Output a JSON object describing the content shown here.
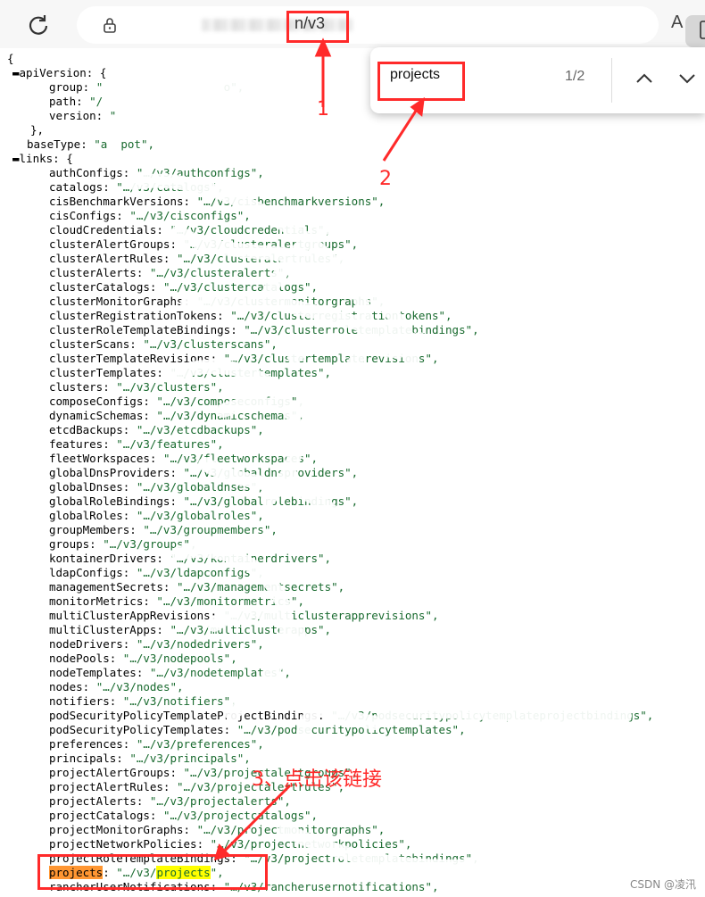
{
  "browser": {
    "url_suffix": "n/v3",
    "find_query": "projects",
    "find_count": "1/2",
    "read_aloud": "A"
  },
  "json_lines": [
    {
      "indent": "{",
      "key": "",
      "value": ""
    },
    {
      "indent": "▬",
      "key": "apiVersion: ",
      "value": "{"
    },
    {
      "indent": "    ",
      "key": "group: ",
      "value": "\"",
      "tail": "o\","
    },
    {
      "indent": "    ",
      "key": "path: ",
      "value": "\"/",
      "tail": ""
    },
    {
      "indent": "    ",
      "key": "version: ",
      "value": "\"",
      "tail": ""
    },
    {
      "indent": "  ",
      "key": "},",
      "value": ""
    },
    {
      "indent": "  ",
      "key": "baseType: ",
      "value": "\"a",
      "tail": "pot\","
    },
    {
      "indent": "▬",
      "key": "links: ",
      "value": "{"
    }
  ],
  "links": [
    {
      "key": "authConfigs",
      "value": "\"…/v3/authconfigs\","
    },
    {
      "key": "catalogs",
      "value": "\"…/v3/catalogs\","
    },
    {
      "key": "cisBenchmarkVersions",
      "value": "\"…/v3/cisbenchmarkversions\","
    },
    {
      "key": "cisConfigs",
      "value": "\"…/v3/cisconfigs\","
    },
    {
      "key": "cloudCredentials",
      "value": "\"…/v3/cloudcredentials\","
    },
    {
      "key": "clusterAlertGroups",
      "value": "\"…/v3/clusteralertgroups\","
    },
    {
      "key": "clusterAlertRules",
      "value": "\"…/v3/clusteralertrules\","
    },
    {
      "key": "clusterAlerts",
      "value": "\"…/v3/clusteralerts\","
    },
    {
      "key": "clusterCatalogs",
      "value": "\"…/v3/clustercatalogs\","
    },
    {
      "key": "clusterMonitorGraphs",
      "value": "\"…/v3/clustermonitorgraphs\","
    },
    {
      "key": "clusterRegistrationTokens",
      "value": "\"…/v3/clusterregistrationtokens\","
    },
    {
      "key": "clusterRoleTemplateBindings",
      "value": "\"…/v3/clusterroletemplatebindings\","
    },
    {
      "key": "clusterScans",
      "value": "\"…/v3/clusterscans\","
    },
    {
      "key": "clusterTemplateRevisions",
      "value": "\"…/v3/clustertemplaterevisions\","
    },
    {
      "key": "clusterTemplates",
      "value": "\"…/v3/clustertemplates\","
    },
    {
      "key": "clusters",
      "value": "\"…/v3/clusters\","
    },
    {
      "key": "composeConfigs",
      "value": "\"…/v3/composeconfigs\","
    },
    {
      "key": "dynamicSchemas",
      "value": "\"…/v3/dynamicschemas\","
    },
    {
      "key": "etcdBackups",
      "value": "\"…/v3/etcdbackups\","
    },
    {
      "key": "features",
      "value": "\"…/v3/features\","
    },
    {
      "key": "fleetWorkspaces",
      "value": "\"…/v3/fleetworkspaces\","
    },
    {
      "key": "globalDnsProviders",
      "value": "\"…/v3/globaldnsproviders\","
    },
    {
      "key": "globalDnses",
      "value": "\"…/v3/globaldnses\","
    },
    {
      "key": "globalRoleBindings",
      "value": "\"…/v3/globalrolebindings\","
    },
    {
      "key": "globalRoles",
      "value": "\"…/v3/globalroles\","
    },
    {
      "key": "groupMembers",
      "value": "\"…/v3/groupmembers\","
    },
    {
      "key": "groups",
      "value": "\"…/v3/groups\","
    },
    {
      "key": "kontainerDrivers",
      "value": "\"…/v3/kontainerdrivers\","
    },
    {
      "key": "ldapConfigs",
      "value": "\"…/v3/ldapconfigs\","
    },
    {
      "key": "managementSecrets",
      "value": "\"…/v3/managementsecrets\","
    },
    {
      "key": "monitorMetrics",
      "value": "\"…/v3/monitormetrics\","
    },
    {
      "key": "multiClusterAppRevisions",
      "value": "\"…/v3/multiclusterapprevisions\","
    },
    {
      "key": "multiClusterApps",
      "value": "\"…/v3/multiclusterapps\","
    },
    {
      "key": "nodeDrivers",
      "value": "\"…/v3/nodedrivers\","
    },
    {
      "key": "nodePools",
      "value": "\"…/v3/nodepools\","
    },
    {
      "key": "nodeTemplates",
      "value": "\"…/v3/nodetemplates\","
    },
    {
      "key": "nodes",
      "value": "\"…/v3/nodes\","
    },
    {
      "key": "notifiers",
      "value": "\"…/v3/notifiers\","
    },
    {
      "key": "podSecurityPolicyTemplateProjectBindings",
      "value": "\"…/v3/podsecuritypolicytemplateprojectbindings\","
    },
    {
      "key": "podSecurityPolicyTemplates",
      "value": "\"…/v3/podsecuritypolicytemplates\","
    },
    {
      "key": "preferences",
      "value": "\"…/v3/preferences\","
    },
    {
      "key": "principals",
      "value": "\"…/v3/principals\","
    },
    {
      "key": "projectAlertGroups",
      "value": "\"…/v3/projectalertgroups\","
    },
    {
      "key": "projectAlertRules",
      "value": "\"…/v3/projectalertrules\","
    },
    {
      "key": "projectAlerts",
      "value": "\"…/v3/projectalerts\","
    },
    {
      "key": "projectCatalogs",
      "value": "\"…/v3/projectcatalogs\","
    },
    {
      "key": "projectMonitorGraphs",
      "value": "\"…/v3/projectmonitorgraphs\","
    },
    {
      "key": "projectNetworkPolicies",
      "value": "\"…/v3/projectnetworkpolicies\","
    },
    {
      "key": "projectRoleTemplateBindings",
      "value": "\"…/v3/projectroletemplatebindings\","
    },
    {
      "key": "projects",
      "value": "\"…/v3/projects\","
    },
    {
      "key": "rancherUserNotifications",
      "value": "\"…/v3/rancherusernotifications\","
    }
  ],
  "annotations": {
    "step1": "1",
    "step2": "2",
    "step3": "3、点击该链接"
  },
  "watermark": "CSDN @凌汛",
  "colors": {
    "annotation_red": "#ff2a2a",
    "json_string_green": "#186a2e",
    "current_match_orange": "#ff9632",
    "match_yellow": "#ffff00"
  }
}
